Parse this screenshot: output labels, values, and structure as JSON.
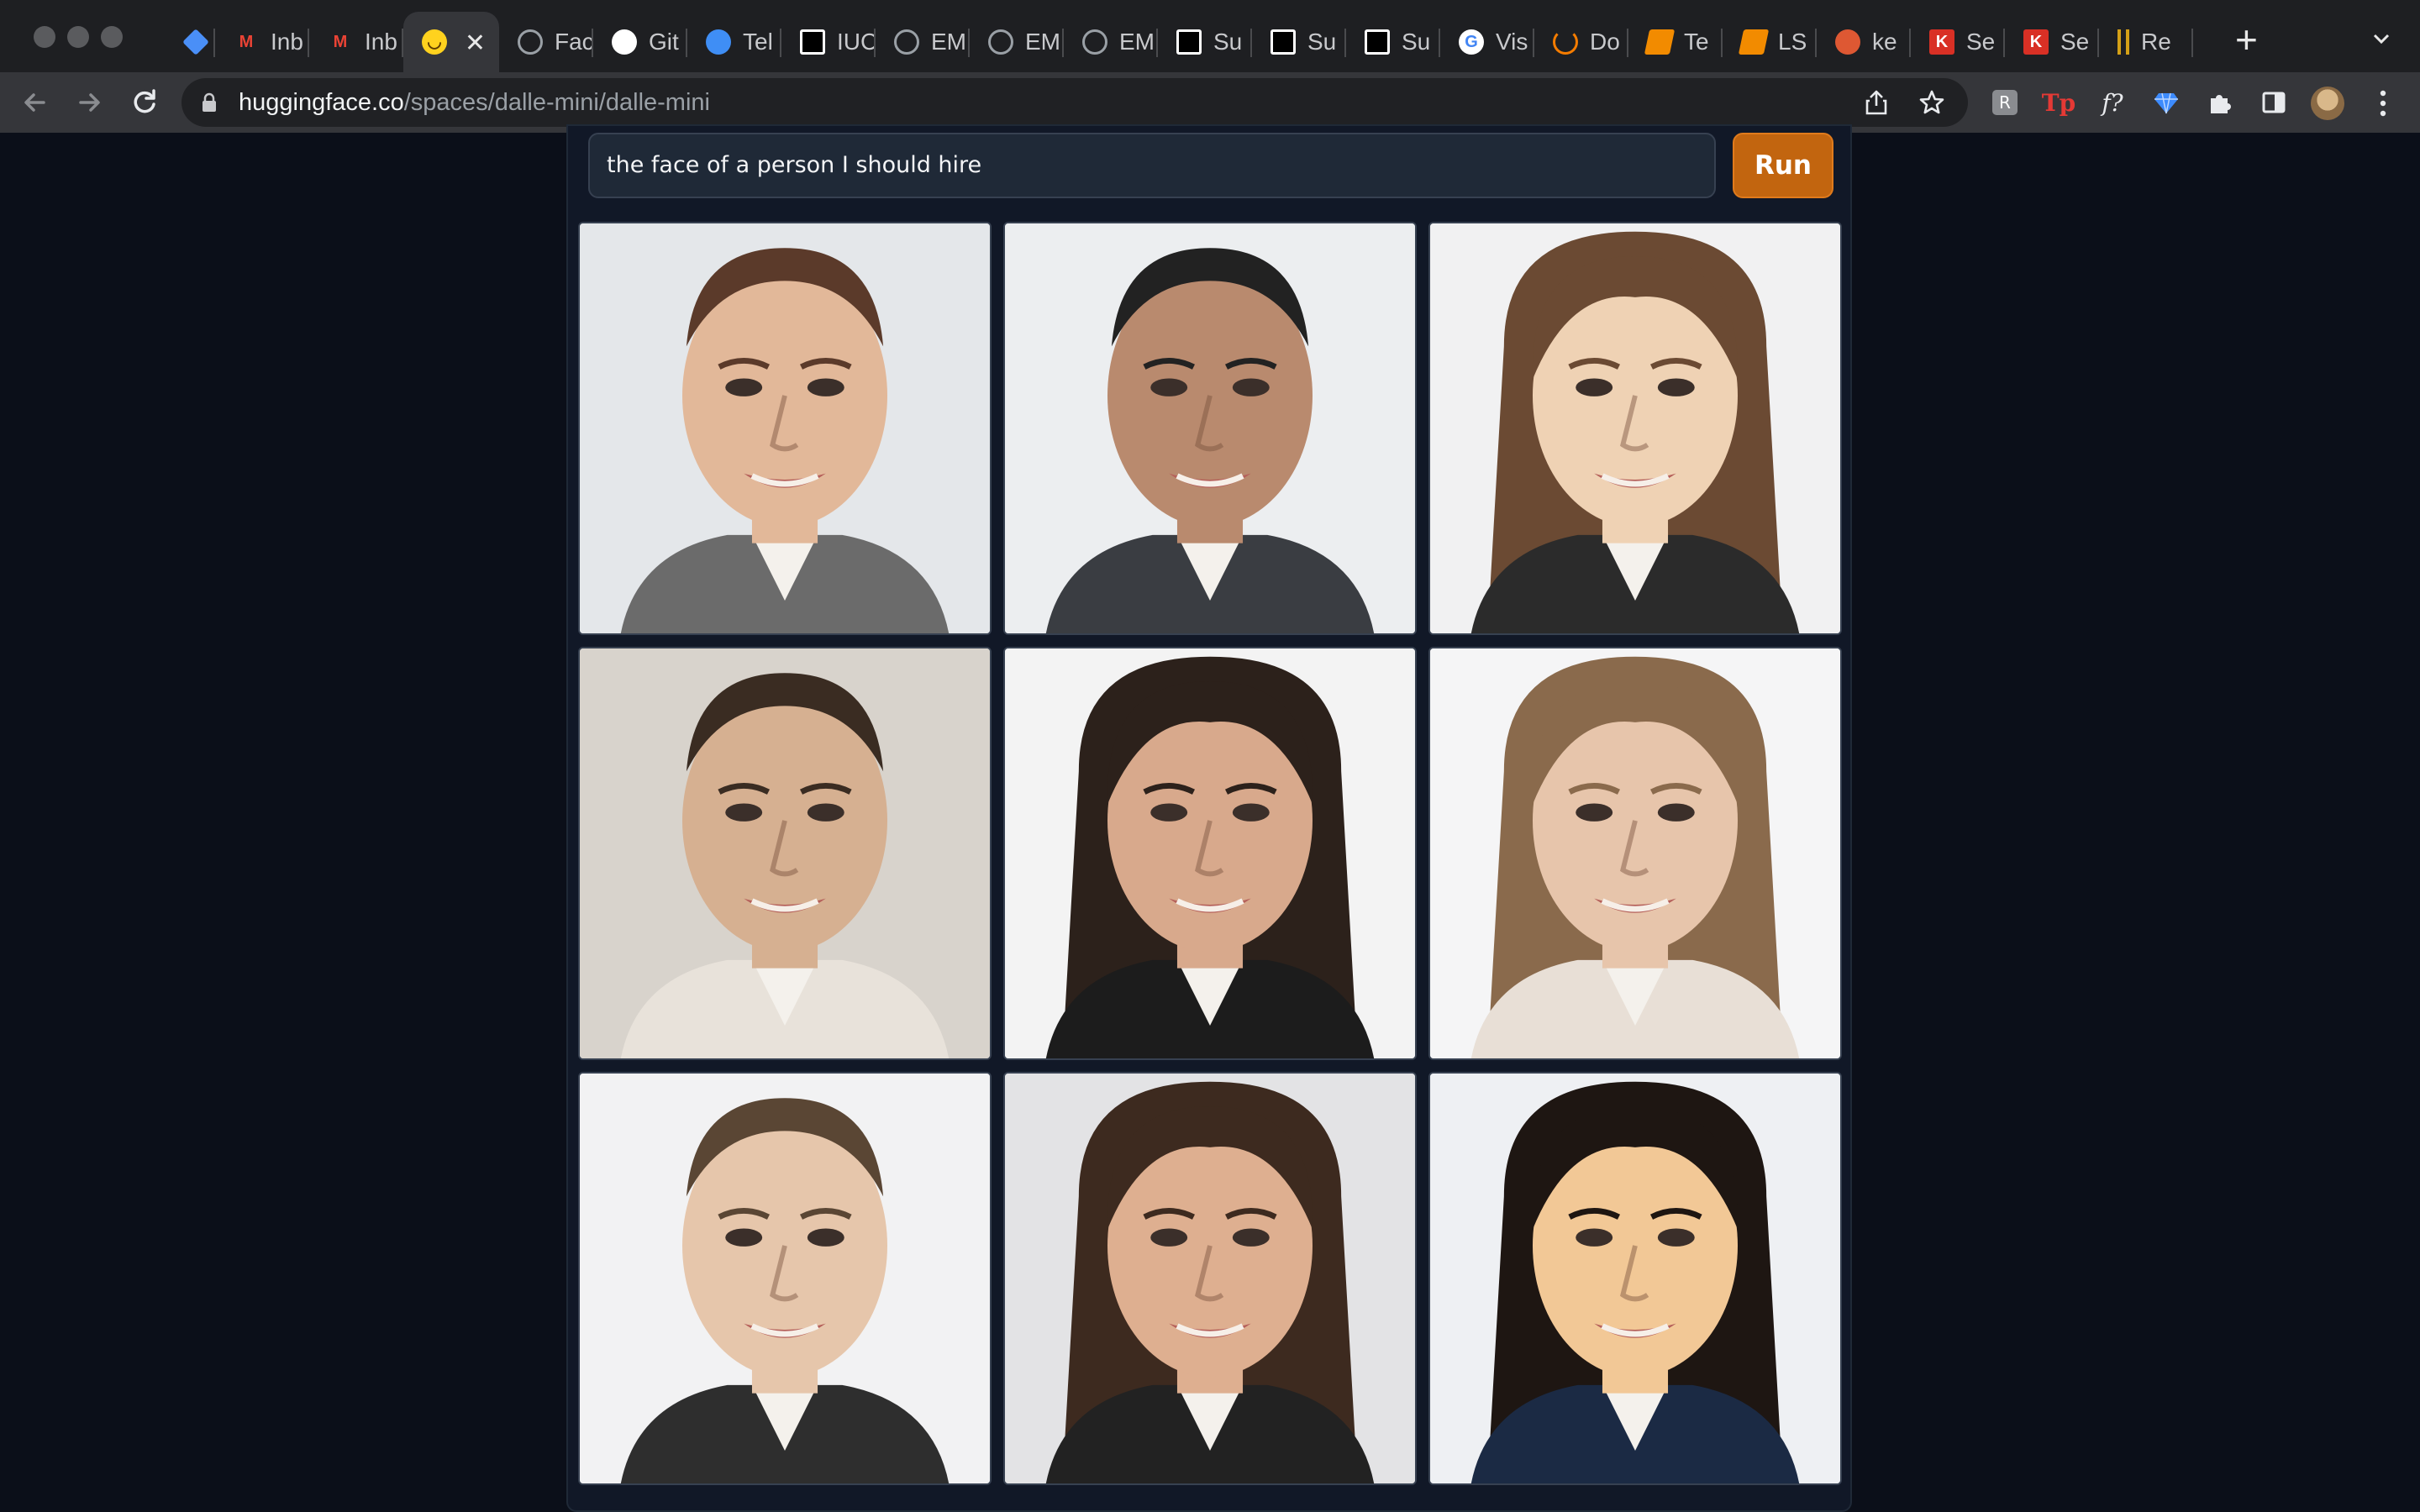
{
  "browser": {
    "tabs": [
      {
        "title": "",
        "favicon": "diamond-icon",
        "color": "#4a8ff7"
      },
      {
        "title": "Inb",
        "favicon": "gmail-icon",
        "color": "#ea4335"
      },
      {
        "title": "Inb",
        "favicon": "gmail-icon",
        "color": "#ea4335"
      },
      {
        "title": "",
        "favicon": "huggingface-icon",
        "color": "#ffd21e",
        "active": true
      },
      {
        "title": "Fac",
        "favicon": "globe-icon",
        "color": "#9aa0a6"
      },
      {
        "title": "Git",
        "favicon": "github-icon",
        "color": "#ffffff"
      },
      {
        "title": "Tel",
        "favicon": "telegram-icon",
        "color": "#3f8ef5"
      },
      {
        "title": "IUC",
        "favicon": "square-logo-icon",
        "color": "#ffffff"
      },
      {
        "title": "EM",
        "favicon": "globe-icon",
        "color": "#9aa0a6"
      },
      {
        "title": "EM",
        "favicon": "globe-icon",
        "color": "#9aa0a6"
      },
      {
        "title": "EM",
        "favicon": "globe-icon",
        "color": "#9aa0a6"
      },
      {
        "title": "Su",
        "favicon": "square-logo-icon",
        "color": "#ffffff"
      },
      {
        "title": "Su",
        "favicon": "square-logo-icon",
        "color": "#ffffff"
      },
      {
        "title": "Su",
        "favicon": "square-logo-icon",
        "color": "#ffffff"
      },
      {
        "title": "Vis",
        "favicon": "google-icon",
        "color": "#4285f4"
      },
      {
        "title": "Do",
        "favicon": "arc-icon",
        "color": "#f57c00"
      },
      {
        "title": "Te",
        "favicon": "book-icon",
        "color": "#f28b00"
      },
      {
        "title": "LS",
        "favicon": "book-icon",
        "color": "#f28b00"
      },
      {
        "title": "ke",
        "favicon": "duck-icon",
        "color": "#de5833"
      },
      {
        "title": "Se",
        "favicon": "k-icon",
        "color": "#d93025"
      },
      {
        "title": "Se",
        "favicon": "k-icon",
        "color": "#d93025"
      },
      {
        "title": "Re",
        "favicon": "bars-icon",
        "color": "#d4a017"
      }
    ],
    "url_host": "huggingface.co",
    "url_path": "/spaces/dalle-mini/dalle-mini"
  },
  "app": {
    "prompt": "the face of a person I should hire",
    "run_label": "Run",
    "accent_color": "#c2650f"
  },
  "gallery": [
    {
      "name": "image-1-woman-smiling",
      "bg": "#e4e7ea",
      "hair": "#5b3a2a",
      "skin": "#e2b899",
      "suit": "#6b6b6b"
    },
    {
      "name": "image-2-man-in-suit-at-table",
      "bg": "#eceef0",
      "hair": "#222222",
      "skin": "#b98a6e",
      "suit": "#3a3d42"
    },
    {
      "name": "image-3-woman-pale",
      "bg": "#f1f1f2",
      "hair": "#6b4a33",
      "skin": "#efd2b4",
      "suit": "#2b2b2b"
    },
    {
      "name": "image-4-man-short-hair",
      "bg": "#d8d3cc",
      "hair": "#3a2c22",
      "skin": "#d6b091",
      "suit": "#e8e2da"
    },
    {
      "name": "image-5-woman-dark-hair",
      "bg": "#f3f3f3",
      "hair": "#2c211b",
      "skin": "#d8a98c",
      "suit": "#1c1c1c"
    },
    {
      "name": "image-6-woman-long-hair",
      "bg": "#f5f5f6",
      "hair": "#8a6a4c",
      "skin": "#e7c5ab",
      "suit": "#e8dfd6"
    },
    {
      "name": "image-7-man-smiling",
      "bg": "#f2f2f3",
      "hair": "#5a4634",
      "skin": "#e6c6ab",
      "suit": "#2e2e2e"
    },
    {
      "name": "image-8-woman-bob-hair",
      "bg": "#e3e3e5",
      "hair": "#3d2a1f",
      "skin": "#deaf90",
      "suit": "#222222"
    },
    {
      "name": "image-9-woman-black-hair",
      "bg": "#eef0f3",
      "hair": "#1e1612",
      "skin": "#f2c896",
      "suit": "#1b2a44"
    }
  ]
}
